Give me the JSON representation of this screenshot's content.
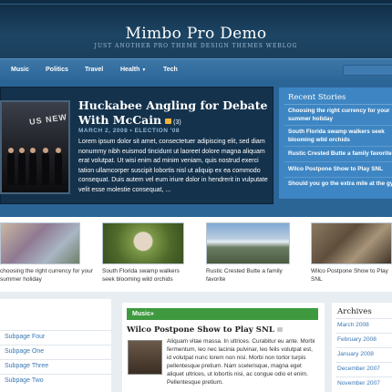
{
  "site": {
    "title": "Mimbo Pro Demo",
    "tagline": "JUST ANOTHER PRO THEME DESIGN THEMES WEBLOG"
  },
  "nav": {
    "items": [
      {
        "label": "Music"
      },
      {
        "label": "Politics"
      },
      {
        "label": "Travel"
      },
      {
        "label": "Health",
        "has_dropdown": true
      },
      {
        "label": "Tech"
      }
    ]
  },
  "feature": {
    "title": "Huckabee Angling for Debate With McCain",
    "comments": "(3)",
    "meta": "MARCH 2, 2008 • ELECTION '08",
    "excerpt": "Lorem ipsum dolor sit amet, consectetuer adipiscing elit, sed diam nonummy nibh euismod tincidunt ut laoreet dolore magna aliquam erat volutpat. Ut wisi enim ad minim veniam, quis nostrud exerci tation ullamcorper suscipit lobortis nisl ut aliquip ex ea commodo consequat. Duis autem vel eum iriure dolor in hendrerit in vulputate velit esse molestie consequat, ...",
    "image_sign": "US NEW"
  },
  "recent": {
    "title": "Recent Stories",
    "items": [
      {
        "label": "Choosing the right currency for your summer holiday"
      },
      {
        "label": "South Florida swamp walkers seek blooming wild orchids"
      },
      {
        "label": "Rustic Crested Butte a family favorite"
      },
      {
        "label": "Wilco Postpone Show to Play SNL"
      },
      {
        "label": "Should you go the extra mile at the gym"
      }
    ]
  },
  "thumbs": [
    {
      "caption": "choosing the right currency for your summer holiday",
      "icon": "currency-photo"
    },
    {
      "caption": "South Florida swamp walkers seek blooming wild orchids",
      "icon": "orchid-photo"
    },
    {
      "caption": "Rustic Crested Butte a family favorite",
      "icon": "mountain-photo"
    },
    {
      "caption": "Wilco Postpone Show to Play SNL",
      "icon": "band-photo"
    }
  ],
  "subpages": [
    {
      "label": "Subpage Four"
    },
    {
      "label": "Subpage One"
    },
    {
      "label": "Subpage Three"
    },
    {
      "label": "Subpage Two"
    }
  ],
  "music": {
    "section": "Music»",
    "post_title": "Wilco Postpone Show to Play SNL",
    "post_text": "Aliquam vitae massa. In ultrices. Curabitur eu ante. Morbi fermentum, leo nec lacinia pulvinar, leo felis volutpat est, id volutpat nunc lorem non nisi. Morbi non tortor turpis pellentesque pretium. Nam scelerisque, magna eget aliquet ultrices, ut lobortis nisi, ac congue odio et enim. Pellentesque pretium."
  },
  "archives": {
    "title": "Archives",
    "items": [
      {
        "label": "March 2008"
      },
      {
        "label": "February 2008"
      },
      {
        "label": "January 2008"
      },
      {
        "label": "December 2007"
      },
      {
        "label": "November 2007"
      }
    ]
  },
  "colors": {
    "header_bg": "#1d4564",
    "nav_bg": "#2d6698",
    "recent_bg": "#3e86c3",
    "music_bar": "#3f9a3f",
    "link": "#3a77b3"
  }
}
